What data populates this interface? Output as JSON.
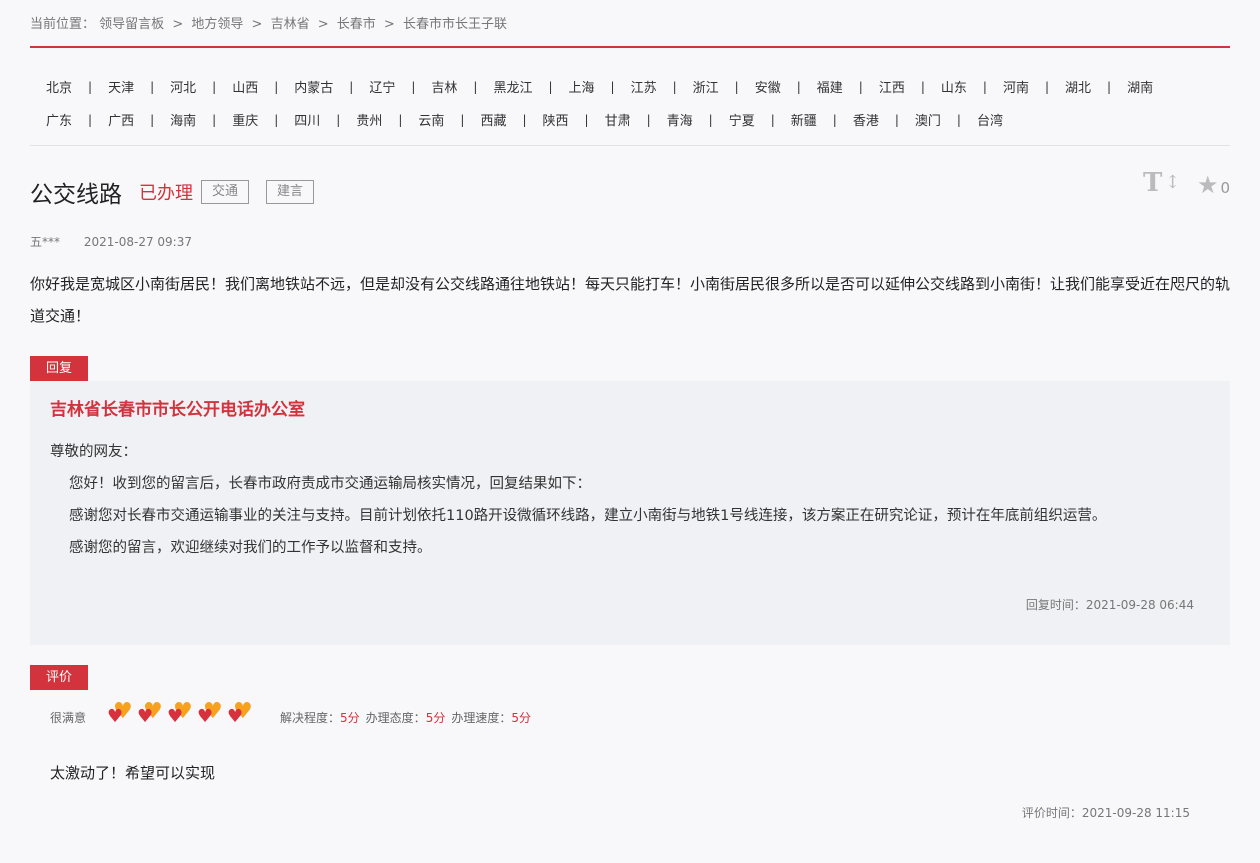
{
  "breadcrumb": {
    "prefix": "当前位置：",
    "items": [
      "领导留言板",
      "地方领导",
      "吉林省",
      "长春市",
      "长春市市长王子联"
    ],
    "separator": ">"
  },
  "regions": {
    "row1": [
      "北京",
      "天津",
      "河北",
      "山西",
      "内蒙古",
      "辽宁",
      "吉林",
      "黑龙江",
      "上海",
      "江苏",
      "浙江",
      "安徽",
      "福建",
      "江西",
      "山东",
      "河南",
      "湖北",
      "湖南"
    ],
    "row2": [
      "广东",
      "广西",
      "海南",
      "重庆",
      "四川",
      "贵州",
      "云南",
      "西藏",
      "陕西",
      "甘肃",
      "青海",
      "宁夏",
      "新疆",
      "香港",
      "澳门",
      "台湾"
    ],
    "separator": "|"
  },
  "post": {
    "title": "公交线路",
    "status": "已办理",
    "tags": [
      "交通",
      "建言"
    ],
    "favorite_count": "0",
    "author": "五***",
    "date": "2021-08-27 09:37",
    "content": "你好我是宽城区小南街居民！我们离地铁站不远，但是却没有公交线路通往地铁站！每天只能打车！小南街居民很多所以是否可以延伸公交线路到小南街！让我们能享受近在咫尺的轨道交通！"
  },
  "reply": {
    "label": "回复",
    "org": "吉林省长春市市长公开电话办公室",
    "greeting": "尊敬的网友：",
    "paragraphs": [
      "您好！收到您的留言后，长春市政府责成市交通运输局核实情况，回复结果如下：",
      "感谢您对长春市交通运输事业的关注与支持。目前计划依托110路开设微循环线路，建立小南街与地铁1号线连接，该方案正在研究论证，预计在年底前组织运营。",
      "感谢您的留言，欢迎继续对我们的工作予以监督和支持。"
    ],
    "time_label": "回复时间：",
    "time": "2021-09-28 06:44"
  },
  "evaluation": {
    "label": "评价",
    "satisfaction": "很满意",
    "hearts": 5,
    "scores": [
      {
        "label": "解决程度：",
        "value": "5分"
      },
      {
        "label": "办理态度：",
        "value": "5分"
      },
      {
        "label": "办理速度：",
        "value": "5分"
      }
    ],
    "comment": "太激动了！希望可以实现",
    "time_label": "评价时间：",
    "time": "2021-09-28 11:15"
  },
  "colors": {
    "accent_red": "#d2333c",
    "heart_orange": "#f7a21e",
    "reply_bg": "#eff1f5"
  }
}
